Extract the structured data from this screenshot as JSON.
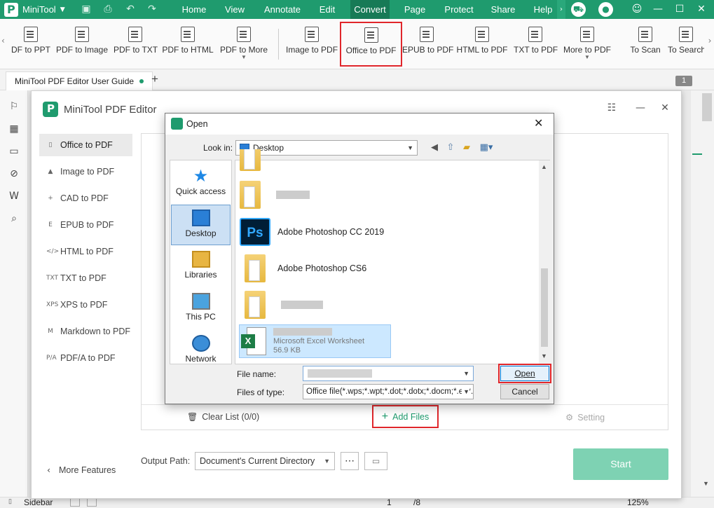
{
  "app": {
    "name": "MiniTool",
    "brand_color": "#1f9b6e"
  },
  "menu": {
    "items": [
      "Home",
      "View",
      "Annotate",
      "Edit",
      "Convert",
      "Page",
      "Protect",
      "Share",
      "Help"
    ],
    "active": "Convert"
  },
  "ribbon": {
    "items": [
      {
        "label": "DF to PPT"
      },
      {
        "label": "PDF to Image"
      },
      {
        "label": "PDF to TXT"
      },
      {
        "label": "PDF to HTML"
      },
      {
        "label": "PDF to More",
        "dropdown": true
      },
      {
        "label": "Image to PDF"
      },
      {
        "label": "Office to PDF",
        "highlighted": true
      },
      {
        "label": "EPUB to PDF"
      },
      {
        "label": "HTML to PDF"
      },
      {
        "label": "TXT to PDF"
      },
      {
        "label": "More to PDF",
        "dropdown": true
      },
      {
        "label": "To Scan"
      },
      {
        "label": "To Search"
      }
    ]
  },
  "tabs": {
    "doc_title": "MiniTool PDF Editor User Guide",
    "add": "+",
    "page_badge": "1"
  },
  "converter": {
    "title": "MiniTool PDF Editor",
    "nav": [
      {
        "label": "Office to PDF",
        "icon": "office-icon",
        "glyph": "▯"
      },
      {
        "label": "Image to PDF",
        "icon": "image-icon",
        "glyph": "▲"
      },
      {
        "label": "CAD to PDF",
        "icon": "cad-icon",
        "glyph": "+"
      },
      {
        "label": "EPUB to PDF",
        "icon": "epub-icon",
        "glyph": "E"
      },
      {
        "label": "HTML to PDF",
        "icon": "html-icon",
        "glyph": "</>"
      },
      {
        "label": "TXT to PDF",
        "icon": "txt-icon",
        "glyph": "TXT"
      },
      {
        "label": "XPS to PDF",
        "icon": "xps-icon",
        "glyph": "XPS"
      },
      {
        "label": "Markdown to PDF",
        "icon": "markdown-icon",
        "glyph": "M"
      },
      {
        "label": "PDF/A to PDF",
        "icon": "pdfa-icon",
        "glyph": "P/A"
      }
    ],
    "clear_list": "Clear List (0/0)",
    "add_files": "Add Files",
    "setting": "Setting",
    "more_features": "More Features",
    "output_path_label": "Output Path:",
    "output_path_value": "Document's Current Directory",
    "start": "Start"
  },
  "dialog": {
    "title": "Open",
    "look_in_label": "Look in:",
    "look_in_value": "Desktop",
    "places": [
      {
        "label": "Quick access",
        "icon": "star-icon"
      },
      {
        "label": "Desktop",
        "icon": "desktop-icon",
        "selected": true
      },
      {
        "label": "Libraries",
        "icon": "libraries-icon"
      },
      {
        "label": "This PC",
        "icon": "computer-icon"
      },
      {
        "label": "Network",
        "icon": "network-icon"
      }
    ],
    "files": [
      {
        "name": "Adobe Photoshop CC 2019",
        "icon": "photoshop-icon",
        "icon_text": "Ps"
      },
      {
        "name": "Adobe Photoshop CS6",
        "icon": "folder-icon"
      },
      {
        "type": "Microsoft Excel Worksheet",
        "size": "56.9 KB",
        "icon": "excel-icon",
        "selected": true
      }
    ],
    "file_name_label": "File name:",
    "file_name_value": "",
    "files_of_type_label": "Files of type:",
    "files_of_type_value": "Office file(*.wps;*.wpt;*.dot;*.dotx;*.docm;*.et;*.e",
    "open_button": "Open",
    "cancel_button": "Cancel"
  },
  "statusbar": {
    "sidebar": "Sidebar",
    "page_total": "/8",
    "page_current": "1",
    "zoom": "125%"
  },
  "highlight_color": "#e0262b"
}
